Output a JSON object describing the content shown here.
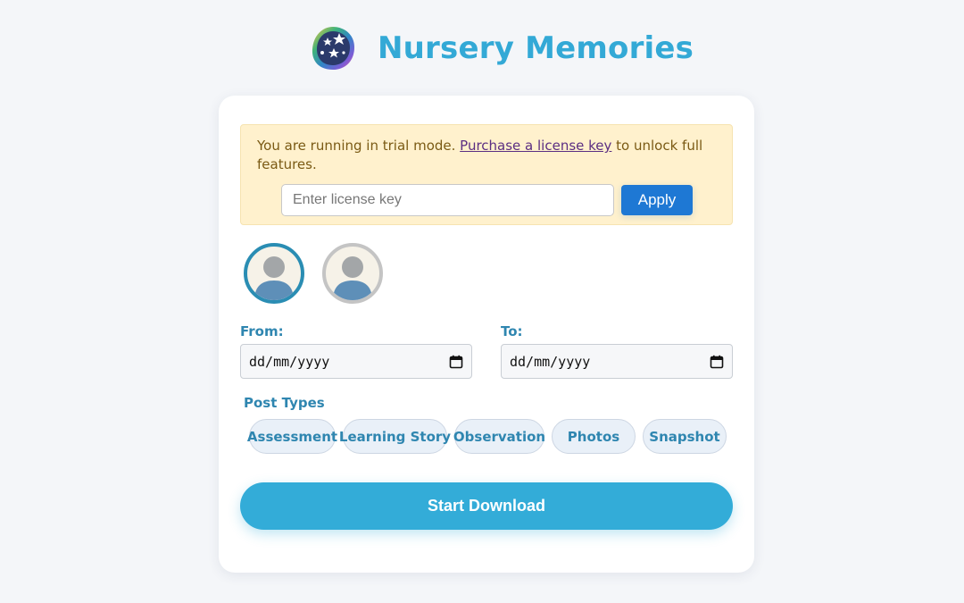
{
  "app": {
    "title": "Nursery Memories",
    "logo_icon": "stars-blob-icon"
  },
  "trial": {
    "text_before": "You are running in trial mode. ",
    "link_text": "Purchase a license key",
    "text_after": " to unlock full features.",
    "license_placeholder": "Enter license key",
    "license_value": "",
    "apply_label": "Apply"
  },
  "children": [
    {
      "icon": "child-avatar-icon",
      "selected": true
    },
    {
      "icon": "child-avatar-icon",
      "selected": false
    }
  ],
  "dates": {
    "from_label": "From:",
    "from_value": "dd/mm/yyyy",
    "to_label": "To:",
    "to_value": "dd/mm/yyyy",
    "icon": "calendar-icon"
  },
  "post_types": {
    "label": "Post Types",
    "options": [
      "Assessment",
      "Learning Story",
      "Observation",
      "Photos",
      "Snapshot"
    ]
  },
  "download_label": "Start Download",
  "colors": {
    "accent": "#33a9d6",
    "apply_button": "#1e78d4",
    "trial_background": "#fff1cd",
    "page_background": "#f4f6f9"
  }
}
